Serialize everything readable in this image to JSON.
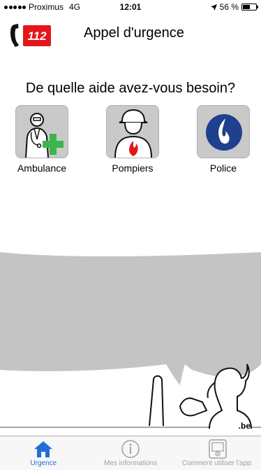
{
  "status_bar": {
    "carrier": "Proximus",
    "network": "4G",
    "time": "12:01",
    "battery": "56 %"
  },
  "header": {
    "title": "Appel d'urgence",
    "logo_number": "112"
  },
  "question": "De quelle aide avez-vous besoin?",
  "services": [
    {
      "label": "Ambulance",
      "icon": "ambulance-doctor-icon"
    },
    {
      "label": "Pompiers",
      "icon": "firefighter-icon"
    },
    {
      "label": "Police",
      "icon": "police-flame-icon"
    }
  ],
  "footer_logo": ".be",
  "tabs": [
    {
      "label": "Urgence",
      "icon": "home-icon",
      "active": true
    },
    {
      "label": "Mes informations",
      "icon": "info-icon",
      "active": false
    },
    {
      "label": "Comment utiliser l'app:",
      "icon": "video-icon",
      "active": false
    }
  ],
  "colors": {
    "accent": "#1e6fd9",
    "logo_red": "#e3161b",
    "tile_gray": "#c9c9c9",
    "bubble_gray": "#c4c4c4",
    "police_blue": "#1f3f8f",
    "ambulance_green": "#3db54a"
  }
}
